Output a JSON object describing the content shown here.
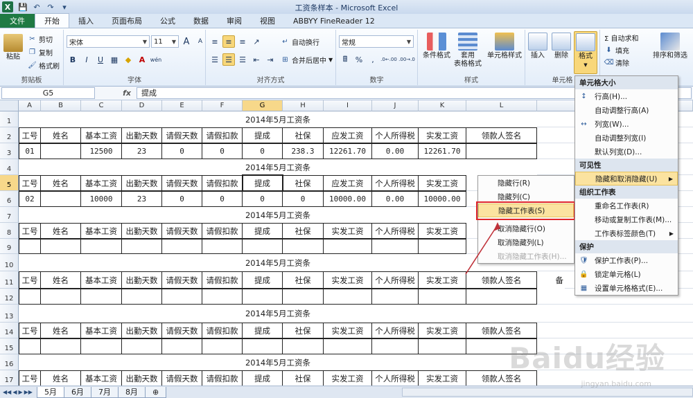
{
  "window": {
    "title": "工资条样本 - Microsoft Excel",
    "qat": [
      "💾",
      "↶",
      "↷",
      "▾"
    ]
  },
  "tabs": [
    "文件",
    "开始",
    "插入",
    "页面布局",
    "公式",
    "数据",
    "审阅",
    "视图",
    "ABBYY FineReader 12"
  ],
  "ribbon": {
    "clipboard": {
      "label": "剪贴板",
      "paste": "粘贴",
      "cut": "剪切",
      "copy": "复制",
      "format_painter": "格式刷"
    },
    "font": {
      "label": "字体",
      "font_name": "宋体",
      "font_size": "11",
      "grow": "A",
      "shrink": "A",
      "bold": "B",
      "italic": "I",
      "underline": "U",
      "wen": "wén"
    },
    "alignment": {
      "label": "对齐方式",
      "wrap": "自动换行",
      "merge": "合并后居中"
    },
    "number": {
      "label": "数字",
      "format": "常规",
      "percent": "%",
      "comma": ",",
      "inc": ".0←.00",
      "dec": ".00→.0"
    },
    "styles": {
      "label": "样式",
      "cond": "条件格式",
      "table": "套用\n表格格式",
      "cell": "单元格样式"
    },
    "cells": {
      "label": "单元格",
      "insert": "插入",
      "delete": "删除",
      "format": "格式"
    },
    "editing": {
      "autosum": "Σ 自动求和",
      "fill": "填充",
      "clear": "清除",
      "sort": "排序和筛选"
    }
  },
  "formula_bar": {
    "name_box": "G5",
    "fx": "fx",
    "content": "提成"
  },
  "columns": [
    "A",
    "B",
    "C",
    "D",
    "E",
    "F",
    "G",
    "H",
    "I",
    "J",
    "K",
    "L",
    "M"
  ],
  "rows": [
    "1",
    "2",
    "3",
    "4",
    "5",
    "6",
    "7",
    "8",
    "9",
    "10",
    "11",
    "12",
    "13",
    "14",
    "15",
    "16",
    "17"
  ],
  "sheet": {
    "title1": "2014年5月工资条",
    "title2": "2014年5月工资条",
    "title3": "2014年5月工资条",
    "title4": "2014年5月工资条",
    "title5": "2014年5月工资条",
    "title6": "2014年5月工资条",
    "header_row2": [
      "工号",
      "姓名",
      "基本工资",
      "出勤天数",
      "请假天数",
      "请假扣款",
      "提成",
      "社保",
      "应发工资",
      "个人所得税",
      "实发工资",
      "领款人签名"
    ],
    "data_row3": [
      "01",
      "",
      "12500",
      "23",
      "0",
      "0",
      "0",
      "238.3",
      "12261.70",
      "0.00",
      "12261.70",
      ""
    ],
    "header_row5": [
      "工号",
      "姓名",
      "基本工资",
      "出勤天数",
      "请假天数",
      "请假扣款",
      "提成",
      "社保",
      "应发工资",
      "个人所得税",
      "实发工资"
    ],
    "data_row6": [
      "02",
      "",
      "10000",
      "23",
      "0",
      "0",
      "0",
      "0",
      "10000.00",
      "0.00",
      "10000.00"
    ],
    "header_row8": [
      "工号",
      "姓名",
      "基本工资",
      "出勤天数",
      "请假天数",
      "请假扣款",
      "提成",
      "社保",
      "实发工资",
      "个人所得税",
      "实发工资"
    ],
    "header_row11": [
      "工号",
      "姓名",
      "基本工资",
      "出勤天数",
      "请假天数",
      "请假扣款",
      "提成",
      "社保",
      "实发工资",
      "个人所得税",
      "实发工资",
      "领款人签名",
      "备"
    ],
    "header_row14": [
      "工号",
      "姓名",
      "基本工资",
      "出勤天数",
      "请假天数",
      "请假扣款",
      "提成",
      "社保",
      "实发工资",
      "个人所得税",
      "实发工资",
      "领款人签名"
    ],
    "header_row17": [
      "工号",
      "姓名",
      "基本工资",
      "出勤天数",
      "请假天数",
      "请假扣款",
      "提成",
      "社保",
      "实发工资",
      "个人所得税",
      "实发工资",
      "领款人签名"
    ]
  },
  "sheet_tabs": [
    "5月",
    "6月",
    "7月",
    "8月"
  ],
  "format_menu": {
    "sec_size": "单元格大小",
    "row_height": "行高(H)...",
    "auto_row_height": "自动调整行高(A)",
    "col_width": "列宽(W)...",
    "auto_col_width": "自动调整列宽(I)",
    "default_width": "默认列宽(D)...",
    "sec_visibility": "可见性",
    "hide_unhide": "隐藏和取消隐藏(U)",
    "sec_organize": "组织工作表",
    "rename": "重命名工作表(R)",
    "move_copy": "移动或复制工作表(M)...",
    "tab_color": "工作表标签颜色(T)",
    "sec_protect": "保护",
    "protect_sheet": "保护工作表(P)...",
    "lock_cell": "锁定单元格(L)",
    "format_cells": "设置单元格格式(E)..."
  },
  "hide_submenu": {
    "hide_rows": "隐藏行(R)",
    "hide_cols": "隐藏列(C)",
    "hide_sheet": "隐藏工作表(S)",
    "unhide_rows": "取消隐藏行(O)",
    "unhide_cols": "取消隐藏列(L)",
    "unhide_sheet": "取消隐藏工作表(H)..."
  },
  "watermark": {
    "main": "Baidu经验",
    "sub": "jingyan.baidu.com"
  },
  "colors": {
    "accent": "#1f7a43",
    "highlight": "#fbe3a0",
    "callout": "#e0262a"
  }
}
